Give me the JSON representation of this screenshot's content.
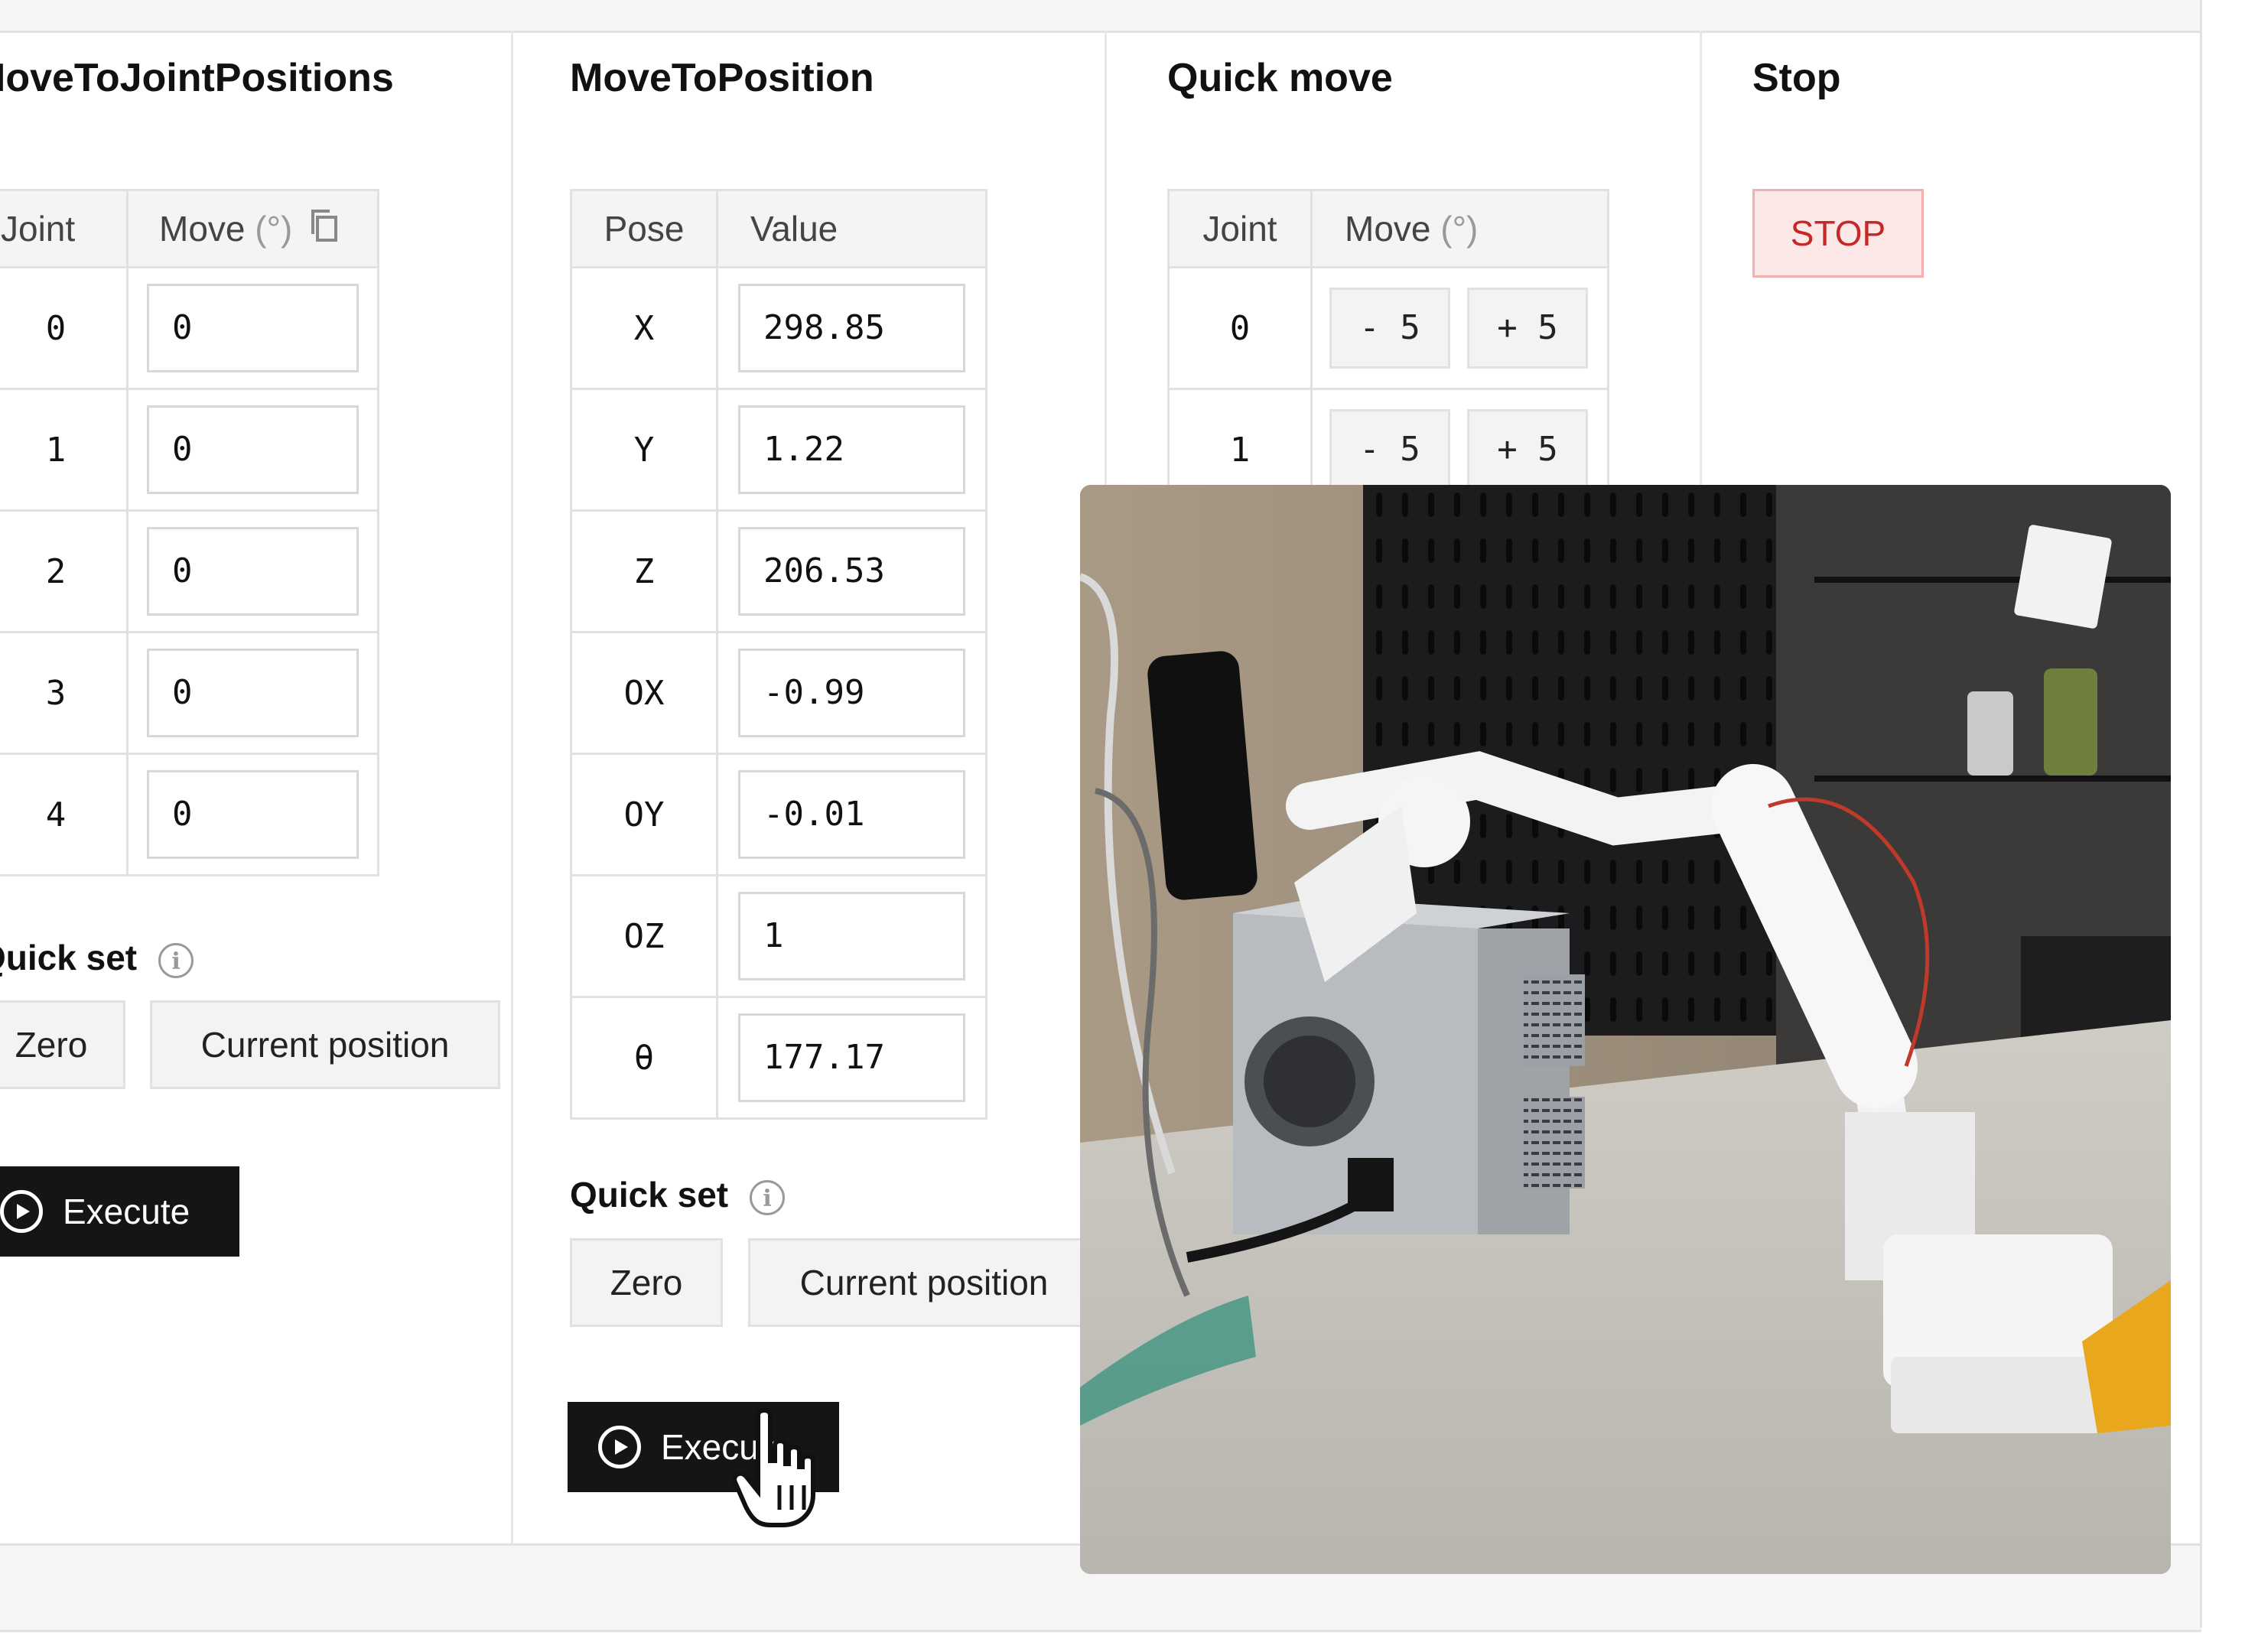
{
  "panels": {
    "joint_positions": {
      "title": "MoveToJointPositions",
      "header_joint": "Joint",
      "header_move": "Move",
      "header_unit": "(°)",
      "copy_icon": "copy-icon",
      "rows": [
        {
          "joint": "0",
          "value": "0"
        },
        {
          "joint": "1",
          "value": "0"
        },
        {
          "joint": "2",
          "value": "0"
        },
        {
          "joint": "3",
          "value": "0"
        },
        {
          "joint": "4",
          "value": "0"
        }
      ],
      "quick_set_label": "Quick set",
      "zero_label": "Zero",
      "current_label": "Current position",
      "execute_label": "Execute"
    },
    "position": {
      "title": "MoveToPosition",
      "header_pose": "Pose",
      "header_value": "Value",
      "rows": [
        {
          "pose": "X",
          "value": "298.85"
        },
        {
          "pose": "Y",
          "value": "1.22"
        },
        {
          "pose": "Z",
          "value": "206.53"
        },
        {
          "pose": "OX",
          "value": "-0.99"
        },
        {
          "pose": "OY",
          "value": "-0.01"
        },
        {
          "pose": "OZ",
          "value": "1"
        },
        {
          "pose": "θ",
          "value": "177.17"
        }
      ],
      "quick_set_label": "Quick set",
      "zero_label": "Zero",
      "current_label": "Current position",
      "execute_label": "Execute"
    },
    "quick_move": {
      "title": "Quick move",
      "header_joint": "Joint",
      "header_move": "Move",
      "header_unit": "(°)",
      "rows": [
        {
          "joint": "0",
          "minus": "- 5",
          "plus": "+ 5"
        },
        {
          "joint": "1",
          "minus": "- 5",
          "plus": "+ 5"
        }
      ]
    },
    "stop": {
      "title": "Stop",
      "button_label": "STOP"
    }
  },
  "colors": {
    "execute_bg": "#151515",
    "stop_bg": "#fde8e8",
    "stop_text": "#c62828"
  }
}
